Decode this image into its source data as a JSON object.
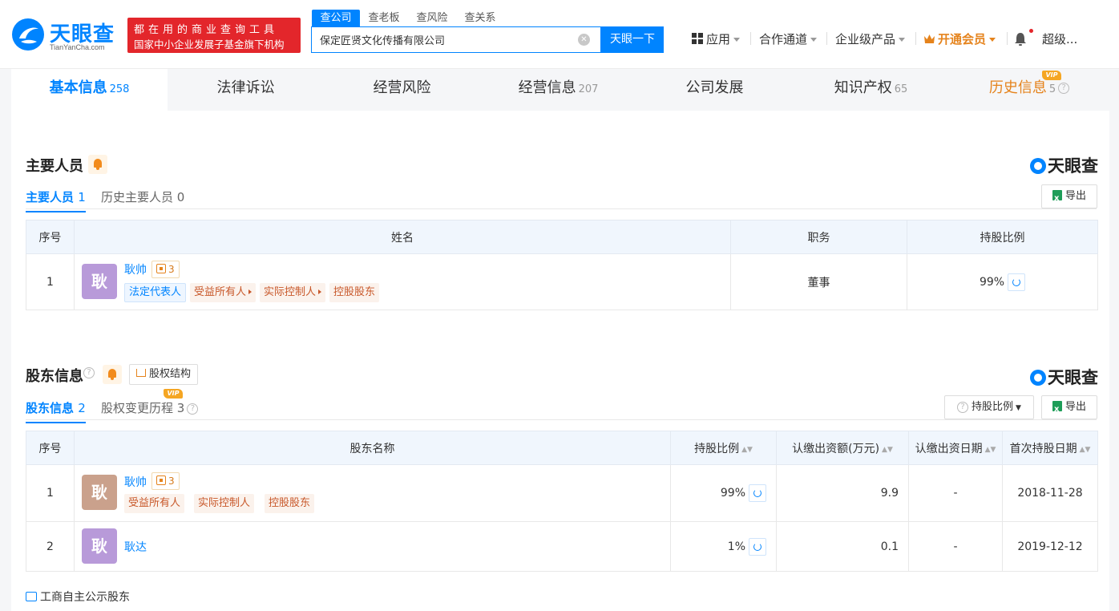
{
  "brand": {
    "name": "天眼查",
    "domain": "TianYanCha.com",
    "slogan_line1": "都在用的商业查询工具",
    "slogan_line2": "国家中小企业发展子基金旗下机构"
  },
  "search": {
    "tabs": [
      "查公司",
      "查老板",
      "查风险",
      "查关系"
    ],
    "active_tab": "查公司",
    "query": "保定匠贤文化传播有限公司",
    "button_label": "天眼一下"
  },
  "nav": {
    "apps": "应用",
    "cooperation": "合作通道",
    "enterprise": "企业级产品",
    "vip": "开通会员",
    "user": "超级..."
  },
  "main_tabs": [
    {
      "label": "基本信息",
      "count": "258"
    },
    {
      "label": "法律诉讼",
      "count": ""
    },
    {
      "label": "经营风险",
      "count": ""
    },
    {
      "label": "经营信息",
      "count": "207"
    },
    {
      "label": "公司发展",
      "count": ""
    },
    {
      "label": "知识产权",
      "count": "65"
    },
    {
      "label": "历史信息",
      "count": "5"
    }
  ],
  "vip_badge": "VIP",
  "key_personnel": {
    "title": "主要人员",
    "brand_label": "天眼查",
    "sub_tabs": [
      {
        "label": "主要人员",
        "count": "1"
      },
      {
        "label": "历史主要人员",
        "count": "0"
      }
    ],
    "export_label": "导出",
    "columns": [
      "序号",
      "姓名",
      "职务",
      "持股比例"
    ],
    "rows": [
      {
        "index": "1",
        "avatar_char": "耿",
        "name": "耿帅",
        "relation_count": "3",
        "tags": [
          "法定代表人",
          "受益所有人",
          "实际控制人",
          "控股股东"
        ],
        "position": "董事",
        "ratio": "99%"
      }
    ]
  },
  "shareholders": {
    "title": "股东信息",
    "equity_button": "股权结构",
    "brand_label": "天眼查",
    "sub_tabs": [
      {
        "label": "股东信息",
        "count": "2"
      },
      {
        "label": "股权变更历程",
        "count": "3"
      }
    ],
    "filter_label": "持股比例",
    "export_label": "导出",
    "columns": [
      "序号",
      "股东名称",
      "持股比例",
      "认缴出资额(万元)",
      "认缴出资日期",
      "首次持股日期"
    ],
    "rows": [
      {
        "index": "1",
        "avatar_char": "耿",
        "name": "耿帅",
        "relation_count": "3",
        "tags": [
          "受益所有人",
          "实际控制人",
          "控股股东"
        ],
        "ratio": "99%",
        "amount": "9.9",
        "date": "-",
        "first_date": "2018-11-28"
      },
      {
        "index": "2",
        "avatar_char": "耿",
        "name": "耿达",
        "ratio": "1%",
        "amount": "0.1",
        "date": "-",
        "first_date": "2019-12-12"
      }
    ],
    "footnote": "工商自主公示股东"
  },
  "colors": {
    "accent": "#0084ff",
    "vip": "#e5831c",
    "slogan_bg": "#e3262b",
    "avatar_purple": "#b89ad9",
    "avatar_brown": "#caa18c"
  }
}
